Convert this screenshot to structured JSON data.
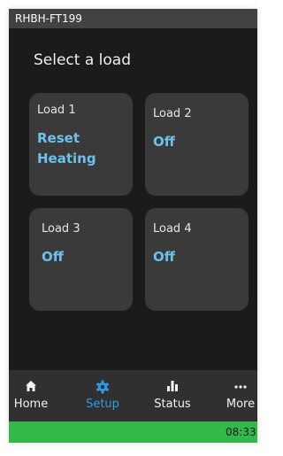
{
  "device_name": "RHBH-FT199",
  "heading": "Select a load",
  "loads": [
    {
      "name": "Load 1",
      "status": "Reset\nHeating"
    },
    {
      "name": "Load 2",
      "status": "Off"
    },
    {
      "name": "Load 3",
      "status": "Off"
    },
    {
      "name": "Load 4",
      "status": "Off"
    }
  ],
  "nav": {
    "home": {
      "label": "Home",
      "icon": "home-icon"
    },
    "setup": {
      "label": "Setup",
      "icon": "gear-icon",
      "active": true
    },
    "status": {
      "label": "Status",
      "icon": "bar-chart-icon"
    },
    "more": {
      "label": "More",
      "icon": "ellipsis-icon"
    }
  },
  "status_bar": {
    "time": "08:33"
  },
  "colors": {
    "accent": "#2f9ae6",
    "load_status": "#6ec1ee",
    "status_bar": "#33b84a",
    "background": "#1b1b1b",
    "tile": "#3a3a3a"
  }
}
